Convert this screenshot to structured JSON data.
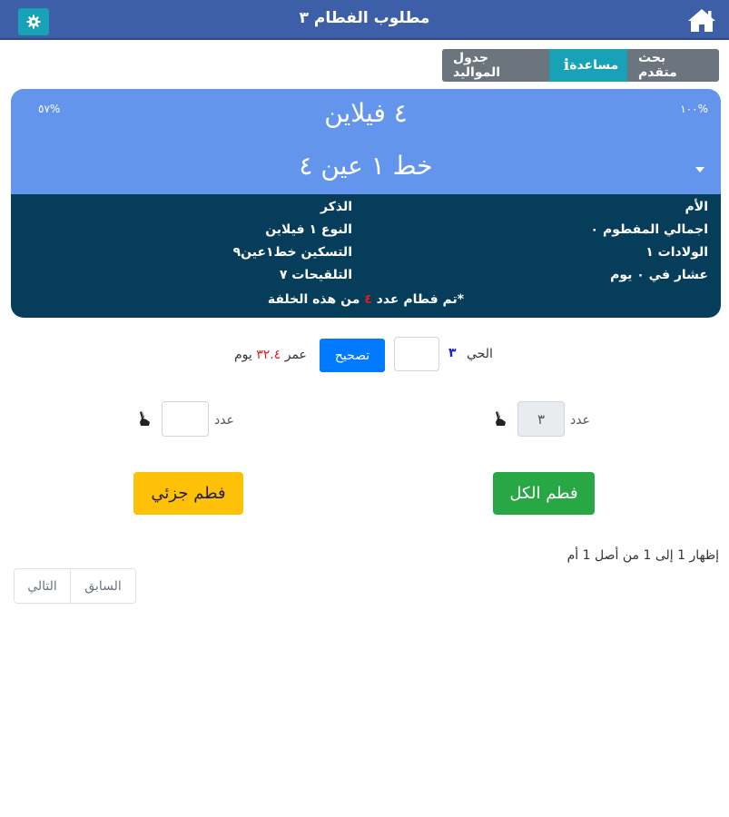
{
  "header": {
    "title": "مطلوب الفطام ٣"
  },
  "tabs": {
    "records": "جدول المواليد",
    "help": "مساعدة",
    "search": "بحث متقدم"
  },
  "card": {
    "percent_left": "٥٧%",
    "percent_right": "١٠٠%",
    "title": "٤ فيلاين",
    "subtitle": "خط ١ عين ٤",
    "right_col": [
      "الأم",
      "اجمالي المفطوم ٠",
      "الولادات ١",
      "عشار في ٠ يوم"
    ],
    "mid_col": [
      "الذكر",
      "النوع ١ فيلاين",
      "التسكين خط١عين٩",
      "التلقيحات ٧"
    ],
    "note_prefix": "*تم فطام عدد",
    "note_count": "٤",
    "note_suffix": "من هذه الخلفة"
  },
  "live_row": {
    "label": "الحي",
    "count": "٣",
    "correct_button": "تصحيح",
    "age_label": "عمر",
    "age_value": "٣٢.٤",
    "age_unit": "يوم"
  },
  "count_row": {
    "label_right": "عدد",
    "value_right": "٣",
    "label_left": "عدد"
  },
  "actions": {
    "wean_all": "فطم الكل",
    "wean_partial": "فطم جزئي"
  },
  "footer": {
    "summary": "إظهار 1 إلى 1 من أصل 1 أم",
    "prev": "السابق",
    "next": "التالي"
  },
  "colors": {
    "topbar": "#3d5fa8",
    "card_top": "#6495ed",
    "card_bottom": "#063d5a",
    "primary": "#007bff",
    "success": "#28a745",
    "warning": "#ffc107",
    "info": "#17a2b8"
  }
}
